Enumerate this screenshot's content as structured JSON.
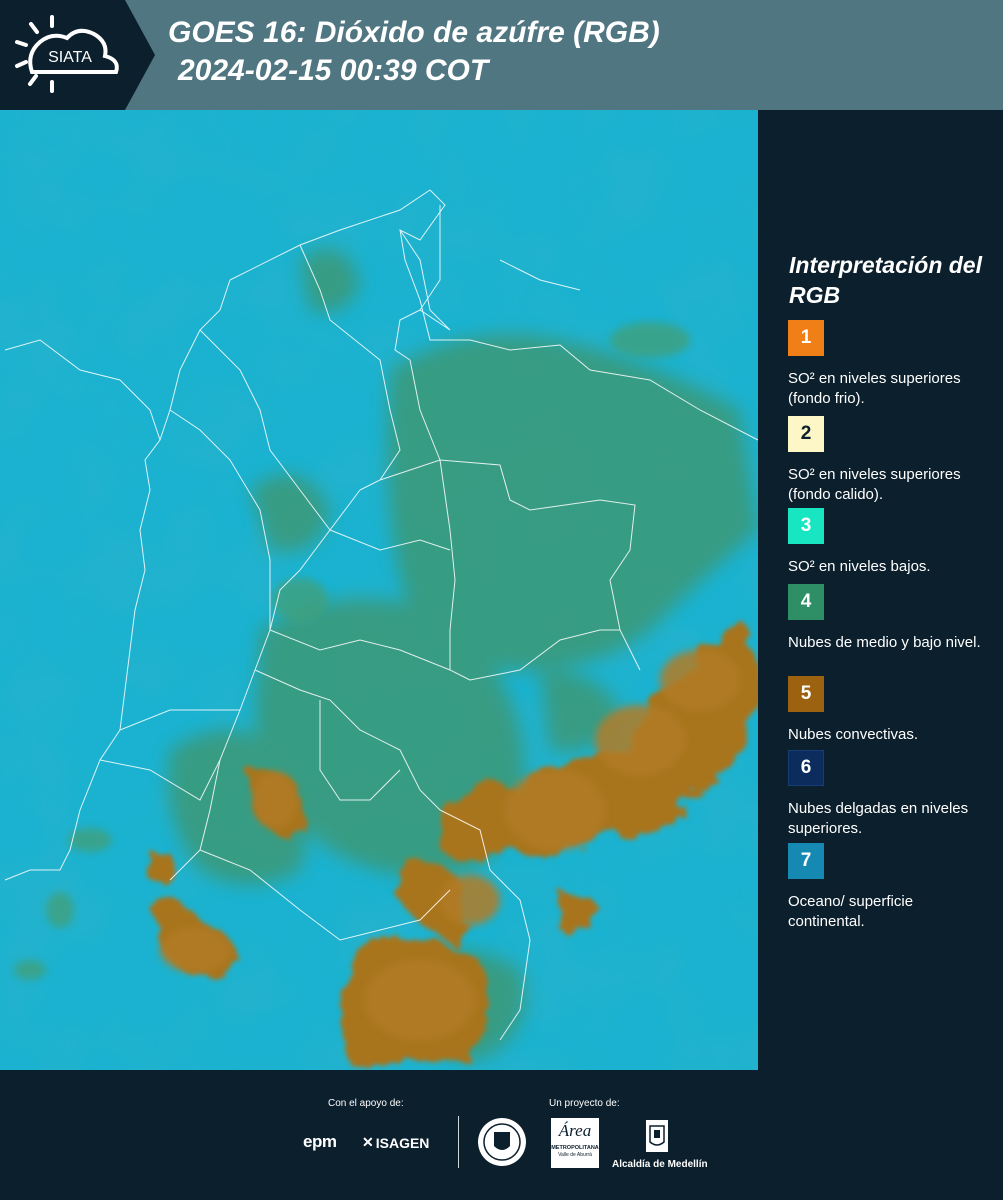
{
  "header": {
    "logo_text": "SIATA",
    "title_line1": "GOES 16: Dióxido de azúfre (RGB)",
    "title_line2": "2024-02-15 00:39 COT"
  },
  "legend": {
    "title": "Interpretación del RGB",
    "items": [
      {
        "num": "1",
        "color": "#ef7f16",
        "label": "SO² en niveles superiores (fondo frio)."
      },
      {
        "num": "2",
        "color": "#fdf7c8",
        "label": "SO² en niveles superiores (fondo calido)."
      },
      {
        "num": "3",
        "color": "#18e6c2",
        "label": "SO² en niveles bajos."
      },
      {
        "num": "4",
        "color": "#2e8e66",
        "label": "Nubes de medio y bajo nivel."
      },
      {
        "num": "5",
        "color": "#9c620f",
        "label": "Nubes convectivas."
      },
      {
        "num": "6",
        "color": "#0b2c5c",
        "label": "Nubes delgadas en niveles superiores."
      },
      {
        "num": "7",
        "color": "#1689b2",
        "label": "Oceano/ superficie continental."
      }
    ]
  },
  "footer": {
    "support_label": "Con el apoyo de:",
    "project_label": "Un proyecto de:",
    "sponsors": [
      "epm",
      "ISAGEN"
    ],
    "partners": [
      "METROPOLITANA",
      "Valle de Aburrá",
      "Alcaldía de Medellín"
    ],
    "area_logo_text": "Área"
  },
  "colors": {
    "background": "#0c1f2c",
    "header_band": "#4f7681",
    "ocean": "#1ab0cf",
    "land_cloud": "#3a9a7e",
    "convective": "#a8731f"
  }
}
